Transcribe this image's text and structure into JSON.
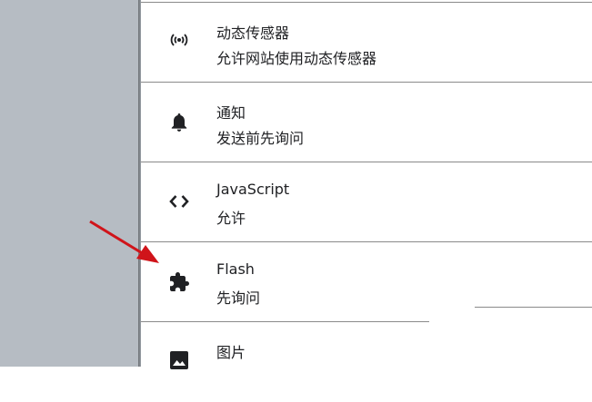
{
  "settings": {
    "items": [
      {
        "title": "动态传感器",
        "subtitle": "允许网站使用动态传感器",
        "icon": "sensors-icon"
      },
      {
        "title": "通知",
        "subtitle": "发送前先询问",
        "icon": "bell-icon"
      },
      {
        "title": "JavaScript",
        "subtitle": "允许",
        "icon": "code-icon"
      },
      {
        "title": "Flash",
        "subtitle": "先询问",
        "icon": "puzzle-icon"
      },
      {
        "title": "图片",
        "subtitle": "",
        "icon": "image-icon"
      }
    ]
  },
  "colors": {
    "side_panel": "#b6bcc3",
    "divider": "#8a8a8a",
    "annotation_arrow": "#d0141a"
  }
}
